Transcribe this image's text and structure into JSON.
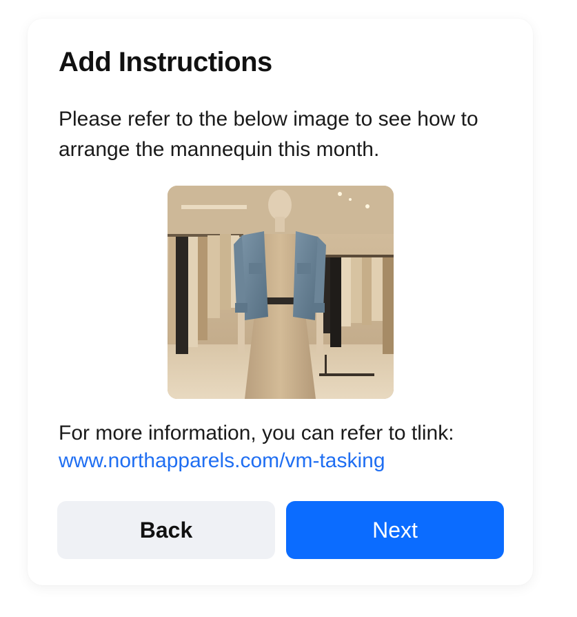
{
  "dialog": {
    "title": "Add Instructions",
    "description": "Please refer to the below image to see how to arrange the mannequin this month.",
    "image": {
      "subject": "mannequin-wearing-denim-jacket-and-beige-dress-in-clothing-store"
    },
    "info_text": "For more information, you can refer to tlink:",
    "link_text": "www.northapparels.com/vm-tasking"
  },
  "buttons": {
    "back_label": "Back",
    "next_label": "Next"
  },
  "colors": {
    "accent": "#0b6cff",
    "link": "#1f6ef2",
    "secondary_button": "#eff1f5",
    "text": "#111111"
  }
}
